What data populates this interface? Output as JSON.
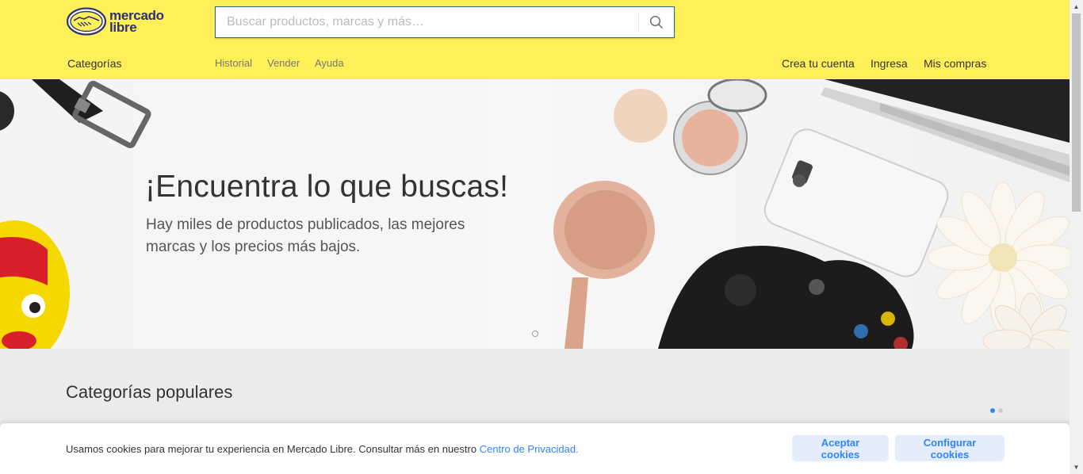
{
  "header": {
    "logo_line1": "mercado",
    "logo_line2": "libre",
    "search_placeholder": "Buscar productos, marcas y más…",
    "nav": {
      "categories": "Categorías",
      "history": "Historial",
      "sell": "Vender",
      "help": "Ayuda",
      "create_account": "Crea tu cuenta",
      "login": "Ingresa",
      "purchases": "Mis compras"
    }
  },
  "hero": {
    "title": "¡Encuentra lo que buscas!",
    "subtitle": "Hay miles de productos publicados, las mejores marcas y los precios más bajos."
  },
  "main": {
    "section_title": "Categorías populares"
  },
  "cookie_banner": {
    "text": "Usamos cookies para mejorar tu experiencia en Mercado Libre. Consultar más en nuestro ",
    "link": "Centro de Privacidad.",
    "accept": "Aceptar cookies",
    "configure": "Configurar cookies"
  },
  "colors": {
    "brand_yellow": "#fff059",
    "accent_blue": "#3483fa",
    "logo_navy": "#2d3277"
  }
}
